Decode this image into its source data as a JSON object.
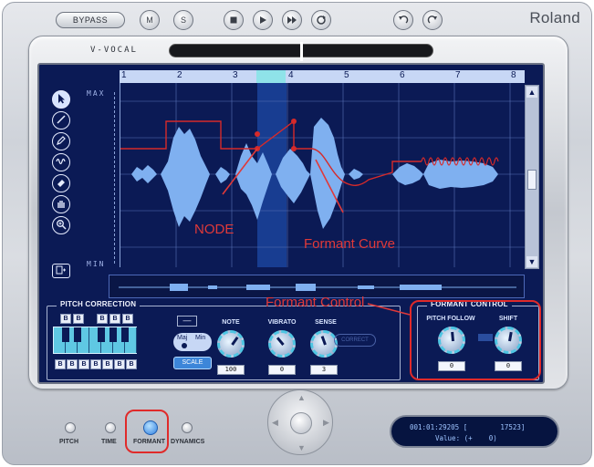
{
  "topbar": {
    "bypass": "BYPASS",
    "m": "M",
    "s": "S",
    "brand": "Roland"
  },
  "module": {
    "title": "V-VOCAL"
  },
  "ruler": {
    "marks": [
      "1",
      "2",
      "3",
      "4",
      "5",
      "6",
      "7",
      "8"
    ]
  },
  "editor": {
    "max": "MAX",
    "min": "MIN"
  },
  "annotations": {
    "node": "NODE",
    "formant_curve": "Formant Curve",
    "formant_control": "Formant Control"
  },
  "pitch_correction": {
    "title": "PITCH CORRECTION",
    "top_keys": [
      "B",
      "B",
      "B",
      "B",
      "B"
    ],
    "bottom_keys": [
      "B",
      "B",
      "B",
      "B",
      "B",
      "B",
      "B"
    ],
    "minus": "—",
    "maj": "Maj",
    "min": "Min",
    "scale": "SCALE",
    "note_label": "NOTE",
    "note_value": "100",
    "vibrato_label": "VIBRATO",
    "vibrato_value": "0",
    "sense_label": "SENSE",
    "sense_value": "3",
    "correct_label": "CORRECT"
  },
  "formant_control": {
    "title": "FORMANT CONTROL",
    "pitch_follow_label": "PITCH FOLLOW",
    "pitch_follow_value": "0",
    "shift_label": "SHIFT",
    "shift_value": "0"
  },
  "modes": {
    "pitch": "PITCH",
    "time": "TIME",
    "formant": "FORMANT",
    "dynamics": "DYNAMICS",
    "active": "formant"
  },
  "lcd": {
    "line1": "001:01:29205 [        17523]",
    "line2": "Value: (+    0)"
  },
  "colors": {
    "screen_bg": "#0b1a55",
    "waveform": "#7fb0f0",
    "formant_curve": "#d62a2a",
    "annotation": "#e03939"
  }
}
